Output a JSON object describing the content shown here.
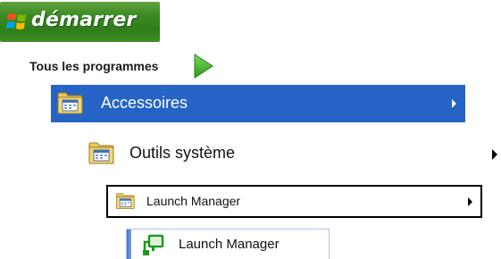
{
  "start": {
    "label": "démarrer",
    "logo_icon": "windows-flag-icon",
    "color": "#3a8a22"
  },
  "all_programs": {
    "label": "Tous les programmes",
    "icon": "green-arrow-right-icon",
    "arrow_color": "#3db52b"
  },
  "menu": {
    "items": [
      {
        "label": "Accessoires",
        "icon": "program-folder-icon",
        "has_submenu": true,
        "highlighted": true,
        "highlight_color": "#2563c6"
      },
      {
        "label": "Outils système",
        "icon": "program-folder-icon",
        "has_submenu": true
      },
      {
        "label": "Launch Manager",
        "icon": "program-folder-icon",
        "has_submenu": true,
        "outlined": true
      },
      {
        "label": "Launch Manager",
        "icon": "launch-manager-app-icon",
        "has_submenu": false
      }
    ]
  }
}
